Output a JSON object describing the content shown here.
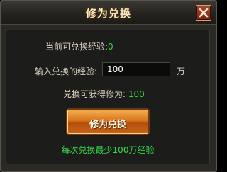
{
  "dialog": {
    "title": "修为兑换",
    "close_icon": "close-icon"
  },
  "form": {
    "current_label": "当前可兑换经验:",
    "current_value": "0",
    "input_label": "输入兑换的经验:",
    "input_value": "100",
    "unit": "万",
    "obtain_label": "兑换可获得修为:",
    "obtain_value": "100"
  },
  "actions": {
    "exchange_label": "修为兑换"
  },
  "hint": "每次兑换最少100万经验",
  "colors": {
    "value_green": "#37d84a",
    "button_orange": "#d9761d",
    "close_red": "#8a2c18",
    "title_text": "#fbe9c6"
  }
}
